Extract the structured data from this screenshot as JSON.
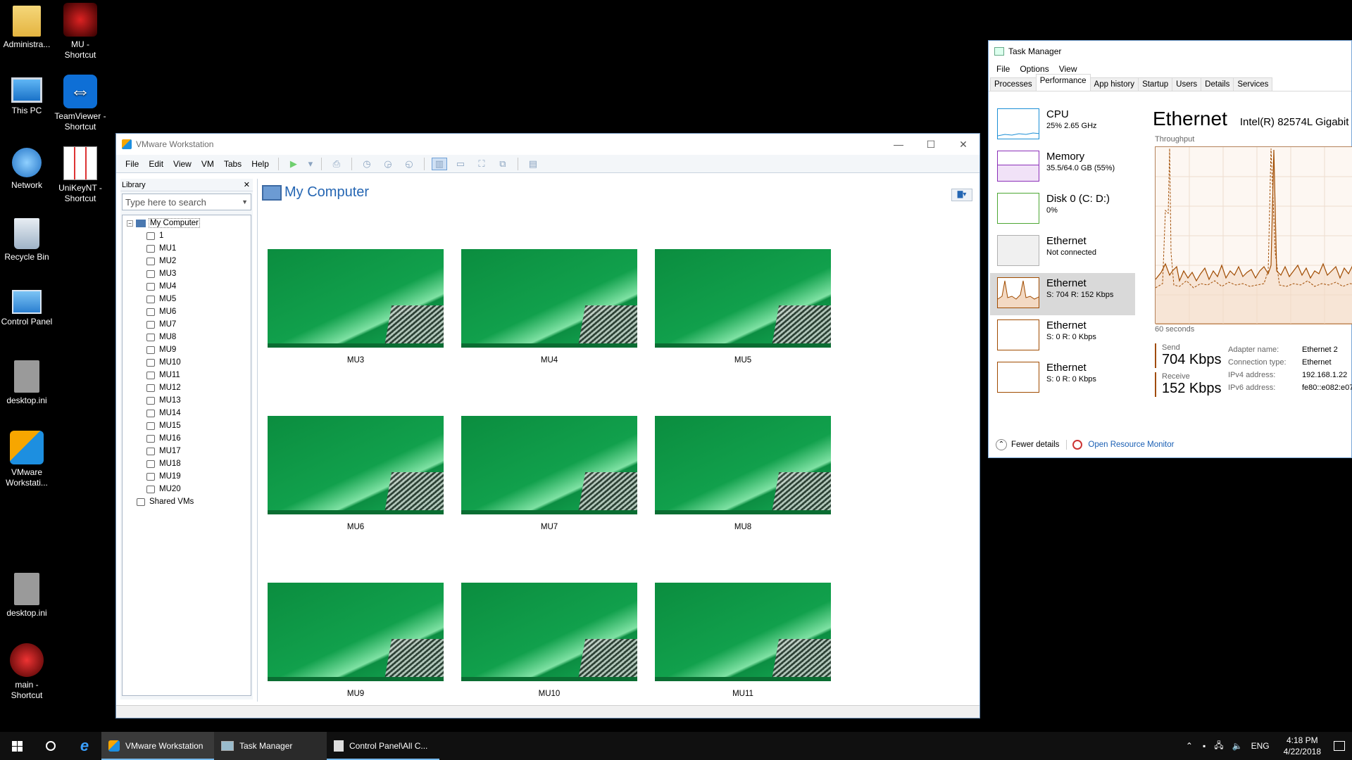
{
  "desktop": {
    "icons": [
      {
        "label": "Administra...",
        "icon": "user-folder-icon"
      },
      {
        "label": "MU -\nShortcut",
        "icon": "mu-game-icon"
      },
      {
        "label": "This PC",
        "icon": "this-pc-icon"
      },
      {
        "label": "TeamViewer -\nShortcut",
        "icon": "teamviewer-icon"
      },
      {
        "label": "Network",
        "icon": "network-icon"
      },
      {
        "label": "UniKeyNT -\nShortcut",
        "icon": "unikey-icon"
      },
      {
        "label": "Recycle Bin",
        "icon": "recycle-bin-icon"
      },
      {
        "label": "Control Panel",
        "icon": "control-panel-icon"
      },
      {
        "label": "desktop.ini",
        "icon": "ini-file-icon"
      },
      {
        "label": "VMware\nWorkstati...",
        "icon": "vmware-icon"
      },
      {
        "label": "desktop.ini",
        "icon": "ini-file-icon"
      },
      {
        "label": "main -\nShortcut",
        "icon": "mu-main-icon"
      }
    ]
  },
  "vmware": {
    "title": "VMware Workstation",
    "menu": [
      "File",
      "Edit",
      "View",
      "VM",
      "Tabs",
      "Help"
    ],
    "library": {
      "title": "Library",
      "search_placeholder": "Type here to search",
      "root": "My Computer",
      "items": [
        "1",
        "MU1",
        "MU2",
        "MU3",
        "MU4",
        "MU5",
        "MU6",
        "MU7",
        "MU8",
        "MU9",
        "MU10",
        "MU11",
        "MU12",
        "MU13",
        "MU14",
        "MU15",
        "MU16",
        "MU17",
        "MU18",
        "MU19",
        "MU20"
      ],
      "shared": "Shared VMs"
    },
    "main_title": "My Computer",
    "thumbnails": [
      "MU3",
      "MU4",
      "MU5",
      "MU6",
      "MU7",
      "MU8",
      "MU9",
      "MU10",
      "MU11"
    ]
  },
  "taskmanager": {
    "title": "Task Manager",
    "menu": [
      "File",
      "Options",
      "View"
    ],
    "tabs": [
      "Processes",
      "Performance",
      "App history",
      "Startup",
      "Users",
      "Details",
      "Services"
    ],
    "active_tab": "Performance",
    "perf_items": [
      {
        "name": "CPU",
        "sub": "25% 2.65 GHz",
        "color": "#1c8fd6"
      },
      {
        "name": "Memory",
        "sub": "35.5/64.0 GB (55%)",
        "color": "#8b2fb8"
      },
      {
        "name": "Disk 0 (C: D:)",
        "sub": "0%",
        "color": "#4da733"
      },
      {
        "name": "Ethernet",
        "sub": "Not connected",
        "color": "#b0b0b0"
      },
      {
        "name": "Ethernet",
        "sub": "S: 704 R: 152 Kbps",
        "color": "#a04b00"
      },
      {
        "name": "Ethernet",
        "sub": "S: 0 R: 0 Kbps",
        "color": "#a04b00"
      },
      {
        "name": "Ethernet",
        "sub": "S: 0 R: 0 Kbps",
        "color": "#a04b00"
      }
    ],
    "selected_index": 4,
    "detail": {
      "heading": "Ethernet",
      "adapter": "Intel(R) 82574L Gigabit",
      "graph_label": "Throughput",
      "time_label": "60 seconds",
      "send_label": "Send",
      "send_value": "704 Kbps",
      "receive_label": "Receive",
      "receive_value": "152 Kbps",
      "props": [
        {
          "k": "Adapter name:",
          "v": "Ethernet 2"
        },
        {
          "k": "Connection type:",
          "v": "Ethernet"
        },
        {
          "k": "IPv4 address:",
          "v": "192.168.1.22"
        },
        {
          "k": "IPv6 address:",
          "v": "fe80::e082:e07"
        }
      ]
    },
    "fewer_details": "Fewer details",
    "resource_monitor": "Open Resource Monitor"
  },
  "taskbar": {
    "apps": [
      {
        "label": "VMware Workstation",
        "icon": "vmware-icon"
      },
      {
        "label": "Task Manager",
        "icon": "task-manager-icon"
      },
      {
        "label": "Control Panel\\All C...",
        "icon": "control-panel-icon"
      }
    ],
    "lang": "ENG",
    "time": "4:18 PM",
    "date": "4/22/2018"
  }
}
